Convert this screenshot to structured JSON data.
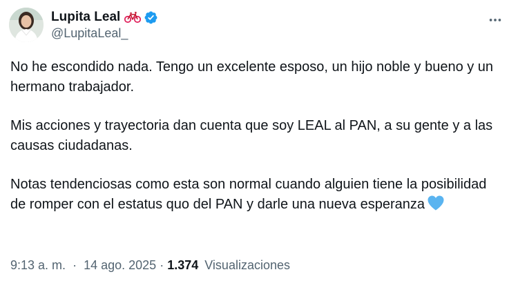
{
  "author": {
    "name": "Lupita Leal",
    "handle": "@LupitaLeal_",
    "name_emoji": "bicycle-icon",
    "verified": true,
    "verified_color": "#1d9bf0"
  },
  "more_options_icon": "ellipsis-icon",
  "tweet": {
    "paragraphs": [
      "No he escondido nada. Tengo un excelente esposo, un hijo noble y bueno y un hermano trabajador.",
      "Mis acciones y trayectoria dan cuenta que soy LEAL al PAN, a su gente y a las causas ciudadanas.",
      "Notas tendenciosas como esta son normal cuando alguien tiene la posibilidad de romper con el estatus quo del PAN y darle una nueva esperanza"
    ],
    "trailing_emoji": "blue-heart-icon",
    "emoji_color": "#5ab4f0"
  },
  "meta": {
    "time": "9:13 a. m.",
    "separator": "·",
    "date": "14 ago. 2025",
    "views_count": "1.374",
    "views_label": "Visualizaciones"
  }
}
